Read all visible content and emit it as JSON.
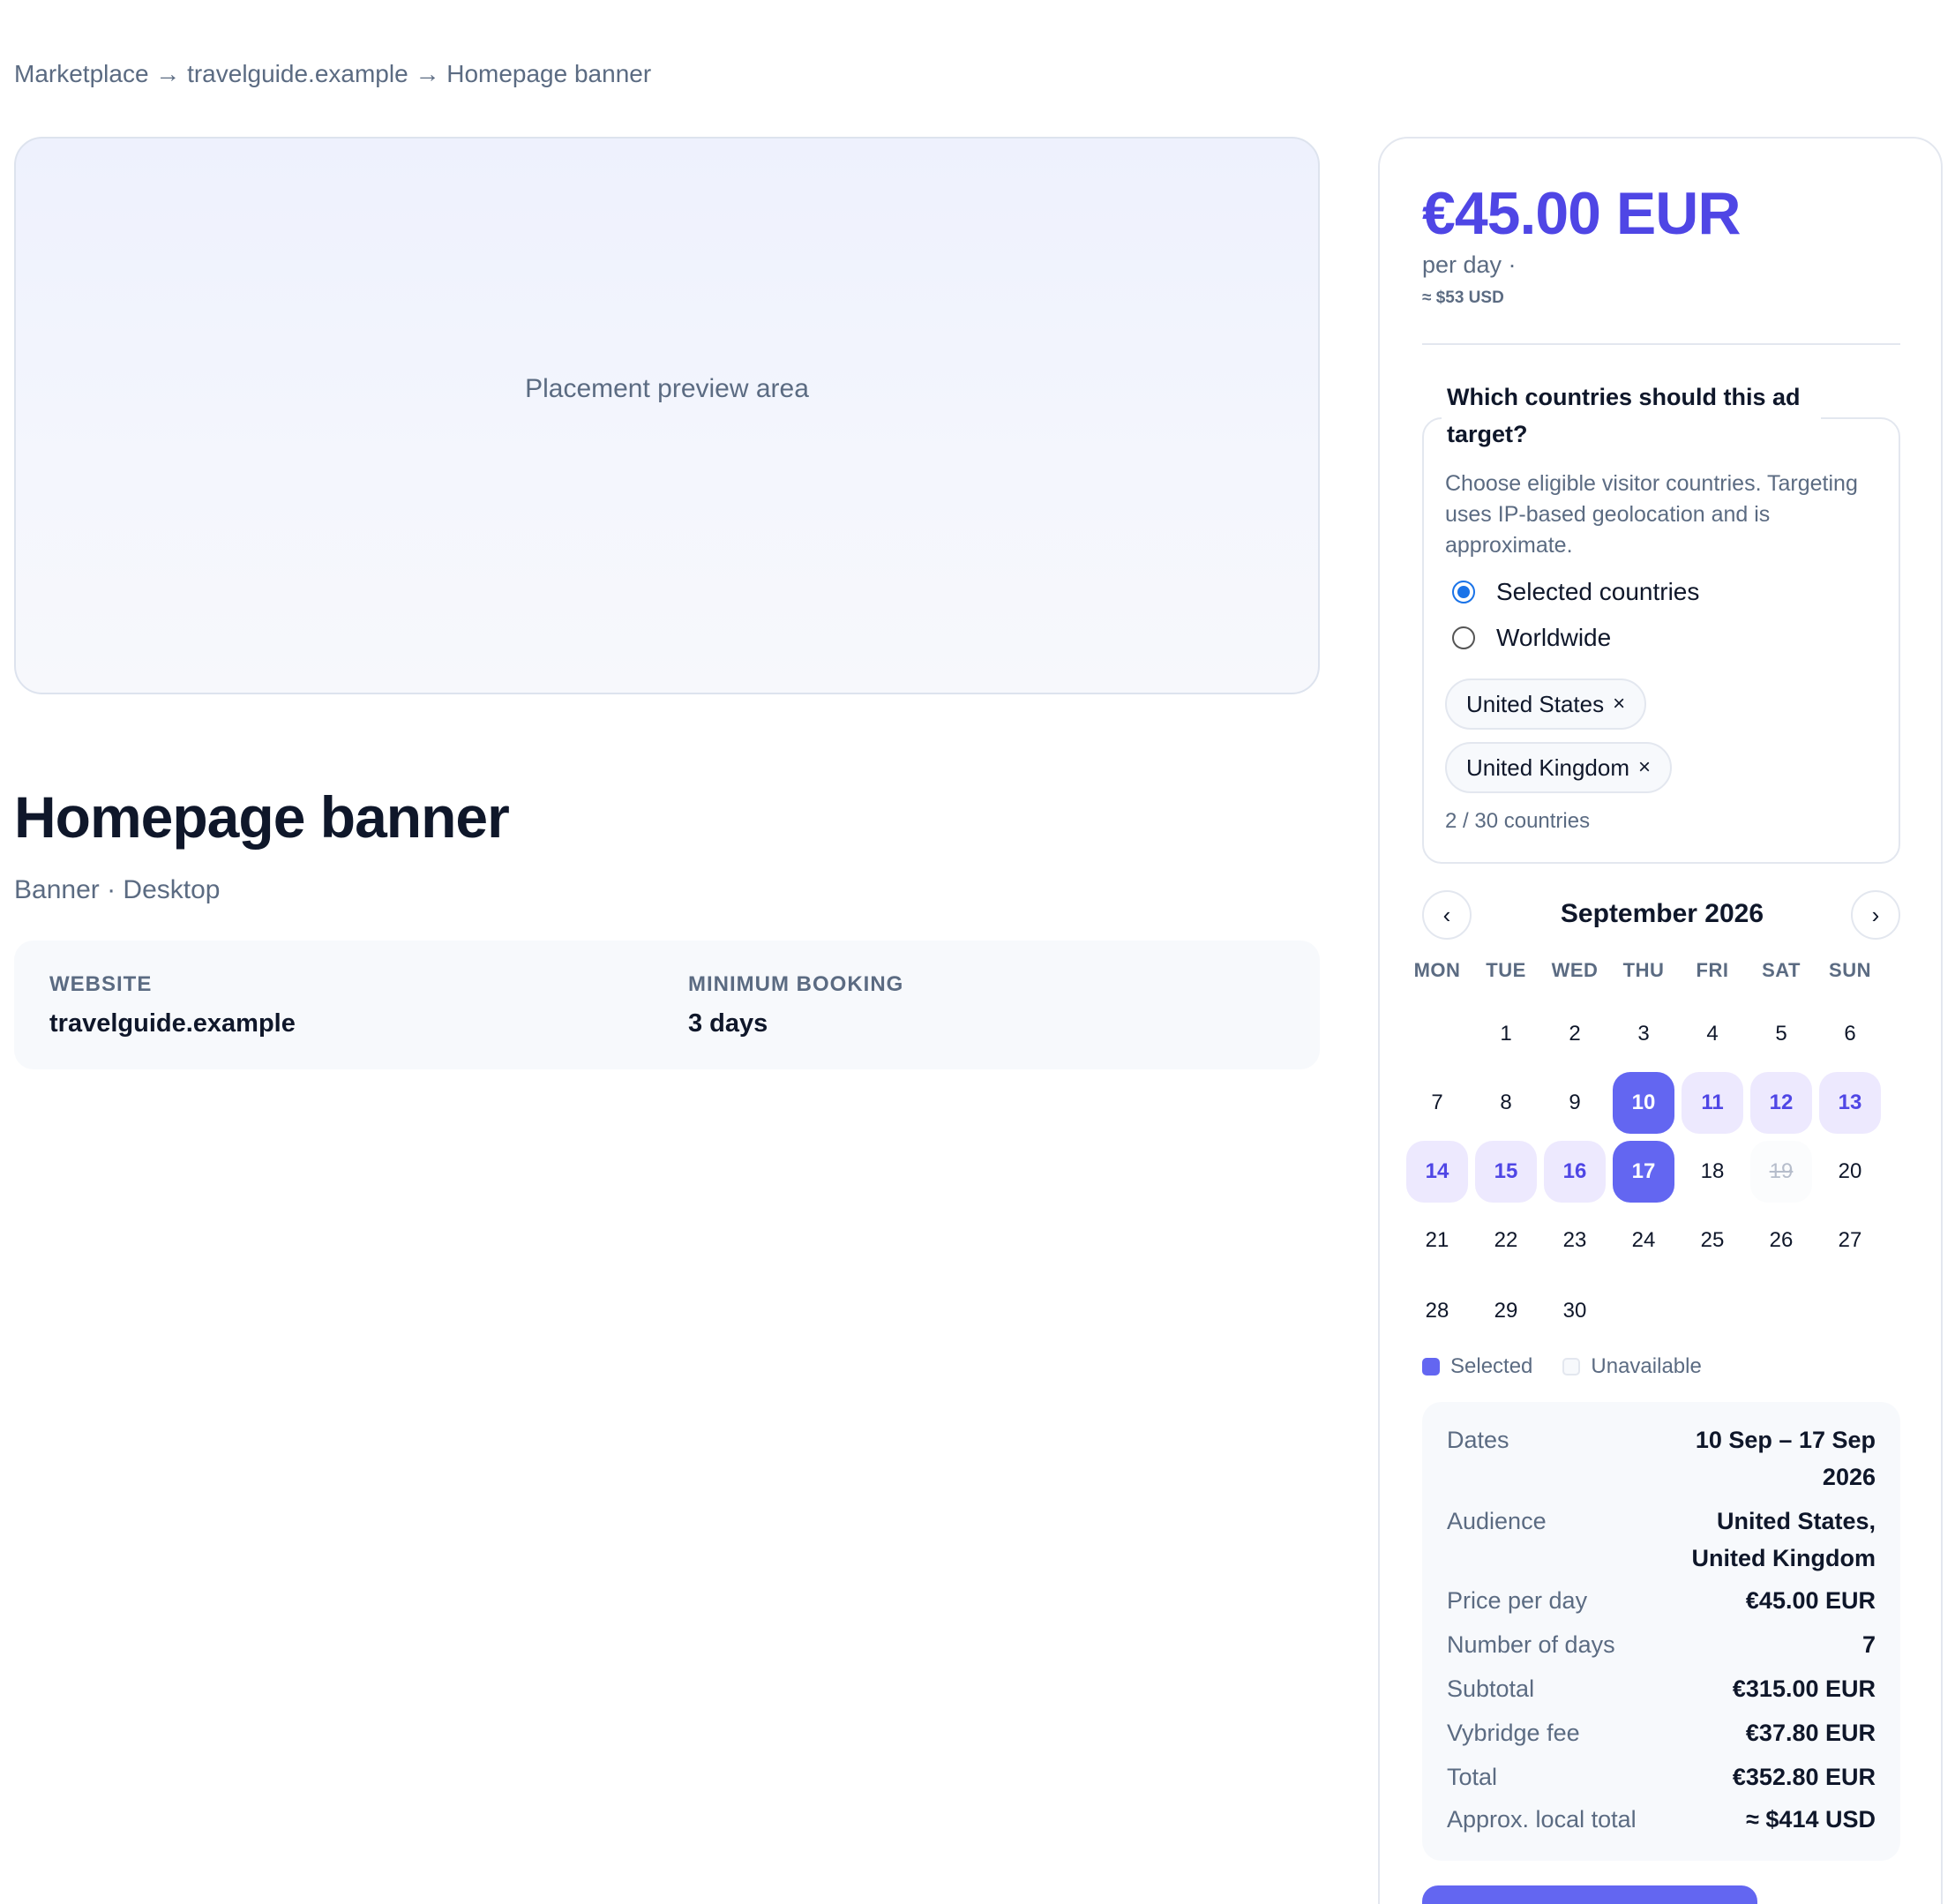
{
  "breadcrumb": "Marketplace → travelguide.example → Homepage banner",
  "preview": {
    "label": "Placement preview area"
  },
  "listing": {
    "title": "Homepage banner",
    "subtitle": "Banner · Desktop",
    "website_label": "WEBSITE",
    "website_value": "travelguide.example",
    "min_booking_label": "MINIMUM BOOKING",
    "min_booking_value": "3 days"
  },
  "pricing": {
    "price": "€45.00 EUR",
    "per_day": "per day ·",
    "approx": "≈ $53 USD"
  },
  "targeting": {
    "question": "Which countries should this ad target?",
    "description": "Choose eligible visitor countries. Targeting uses IP-based geolocation and is approximate.",
    "option_selected": "Selected countries",
    "option_worldwide": "Worldwide",
    "chips": [
      "United States",
      "United Kingdom"
    ],
    "chip_remove": "×",
    "count": "2 / 30 countries"
  },
  "calendar": {
    "prev": "‹",
    "next": "›",
    "month": "September 2026",
    "weekdays": [
      "MON",
      "TUE",
      "WED",
      "THU",
      "FRI",
      "SAT",
      "SUN"
    ],
    "first_weekday_index": 1,
    "days_in_month": 30,
    "range_start": 10,
    "range_end": 17,
    "unavailable": [
      19
    ]
  },
  "legend": {
    "selected": "Selected",
    "unavailable": "Unavailable"
  },
  "summary": [
    {
      "label": "Dates",
      "value": "10 Sep – 17 Sep 2026"
    },
    {
      "label": "Audience",
      "value": "United States, United Kingdom"
    },
    {
      "label": "Price per day",
      "value": "€45.00 EUR"
    },
    {
      "label": "Number of days",
      "value": "7"
    },
    {
      "label": "Subtotal",
      "value": "€315.00 EUR"
    },
    {
      "label": "Vybridge fee",
      "value": "€37.80 EUR"
    },
    {
      "label": "Total",
      "value": "€352.80 EUR"
    },
    {
      "label": "Approx. local total",
      "value": "≈ $414 USD"
    }
  ],
  "colors": {
    "accent": "#6366f1",
    "accent_text": "#4f46e5",
    "range_bg": "#ede9fe",
    "radio": "#1a73e8"
  }
}
